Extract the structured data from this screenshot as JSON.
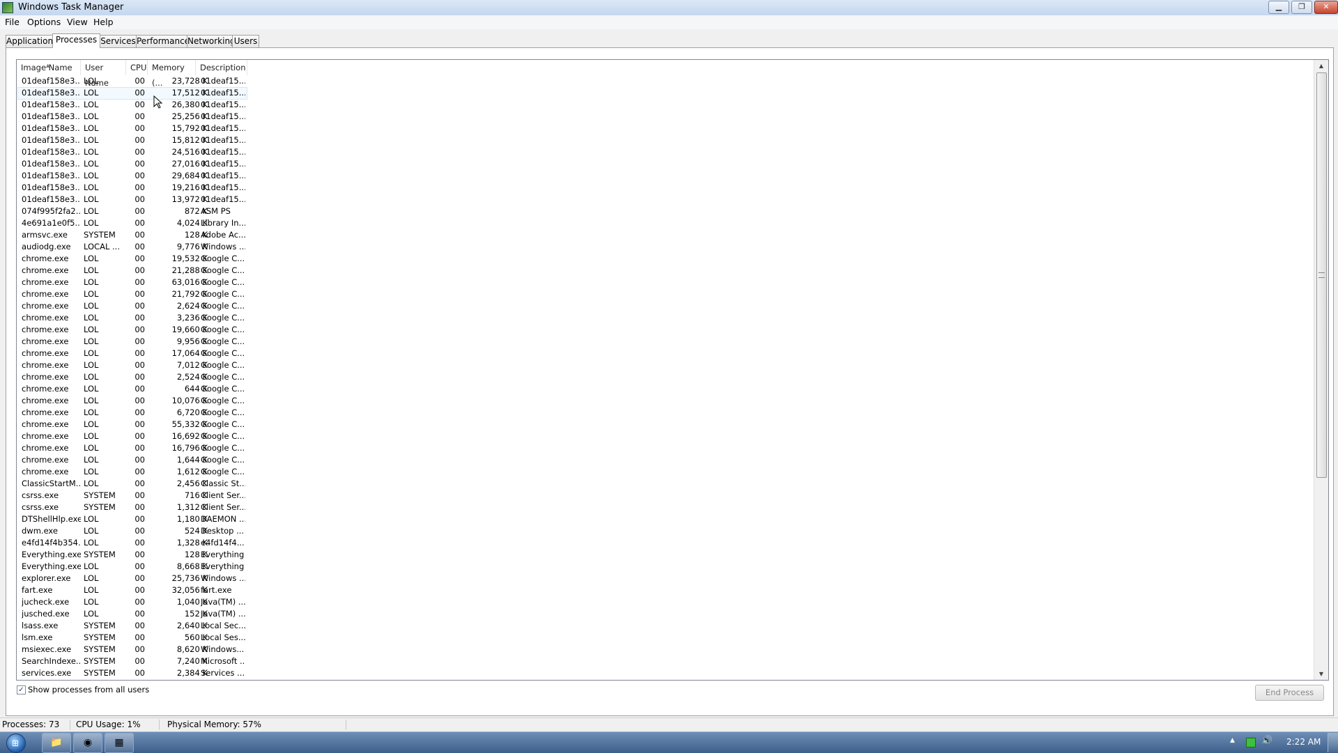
{
  "window": {
    "title": "Windows Task Manager",
    "min_glyph": "▁",
    "max_glyph": "❐",
    "close_glyph": "✕"
  },
  "menu": [
    "File",
    "Options",
    "View",
    "Help"
  ],
  "tabs": [
    "Applications",
    "Processes",
    "Services",
    "Performance",
    "Networking",
    "Users"
  ],
  "active_tab": "Processes",
  "columns": [
    "Image Name",
    "User Name",
    "CPU",
    "Memory (...",
    "Description"
  ],
  "sort_glyph": "▲",
  "processes": [
    [
      "01deaf158e3...",
      "LOL",
      "00",
      "23,728 K",
      "01deaf15..."
    ],
    [
      "01deaf158e3...",
      "LOL",
      "00",
      "17,512 K",
      "01deaf15..."
    ],
    [
      "01deaf158e3...",
      "LOL",
      "00",
      "26,380 K",
      "01deaf15..."
    ],
    [
      "01deaf158e3...",
      "LOL",
      "00",
      "25,256 K",
      "01deaf15..."
    ],
    [
      "01deaf158e3...",
      "LOL",
      "00",
      "15,792 K",
      "01deaf15..."
    ],
    [
      "01deaf158e3...",
      "LOL",
      "00",
      "15,812 K",
      "01deaf15..."
    ],
    [
      "01deaf158e3...",
      "LOL",
      "00",
      "24,516 K",
      "01deaf15..."
    ],
    [
      "01deaf158e3...",
      "LOL",
      "00",
      "27,016 K",
      "01deaf15..."
    ],
    [
      "01deaf158e3...",
      "LOL",
      "00",
      "29,684 K",
      "01deaf15..."
    ],
    [
      "01deaf158e3...",
      "LOL",
      "00",
      "19,216 K",
      "01deaf15..."
    ],
    [
      "01deaf158e3...",
      "LOL",
      "00",
      "13,972 K",
      "01deaf15..."
    ],
    [
      "074f995f2fa2...",
      "LOL",
      "00",
      "872 K",
      "ASM PS"
    ],
    [
      "4e691a1e0f5...",
      "LOL",
      "00",
      "4,024 K",
      "Library In..."
    ],
    [
      "armsvc.exe",
      "SYSTEM",
      "00",
      "128 K",
      "Adobe Ac..."
    ],
    [
      "audiodg.exe",
      "LOCAL ...",
      "00",
      "9,776 K",
      "Windows ..."
    ],
    [
      "chrome.exe",
      "LOL",
      "00",
      "19,532 K",
      "Google C..."
    ],
    [
      "chrome.exe",
      "LOL",
      "00",
      "21,288 K",
      "Google C..."
    ],
    [
      "chrome.exe",
      "LOL",
      "00",
      "63,016 K",
      "Google C..."
    ],
    [
      "chrome.exe",
      "LOL",
      "00",
      "21,792 K",
      "Google C..."
    ],
    [
      "chrome.exe",
      "LOL",
      "00",
      "2,624 K",
      "Google C..."
    ],
    [
      "chrome.exe",
      "LOL",
      "00",
      "3,236 K",
      "Google C..."
    ],
    [
      "chrome.exe",
      "LOL",
      "00",
      "19,660 K",
      "Google C..."
    ],
    [
      "chrome.exe",
      "LOL",
      "00",
      "9,956 K",
      "Google C..."
    ],
    [
      "chrome.exe",
      "LOL",
      "00",
      "17,064 K",
      "Google C..."
    ],
    [
      "chrome.exe",
      "LOL",
      "00",
      "7,012 K",
      "Google C..."
    ],
    [
      "chrome.exe",
      "LOL",
      "00",
      "2,524 K",
      "Google C..."
    ],
    [
      "chrome.exe",
      "LOL",
      "00",
      "644 K",
      "Google C..."
    ],
    [
      "chrome.exe",
      "LOL",
      "00",
      "10,076 K",
      "Google C..."
    ],
    [
      "chrome.exe",
      "LOL",
      "00",
      "6,720 K",
      "Google C..."
    ],
    [
      "chrome.exe",
      "LOL",
      "00",
      "55,332 K",
      "Google C..."
    ],
    [
      "chrome.exe",
      "LOL",
      "00",
      "16,692 K",
      "Google C..."
    ],
    [
      "chrome.exe",
      "LOL",
      "00",
      "16,796 K",
      "Google C..."
    ],
    [
      "chrome.exe",
      "LOL",
      "00",
      "1,644 K",
      "Google C..."
    ],
    [
      "chrome.exe",
      "LOL",
      "00",
      "1,612 K",
      "Google C..."
    ],
    [
      "ClassicStartM...",
      "LOL",
      "00",
      "2,456 K",
      "Classic St..."
    ],
    [
      "csrss.exe",
      "SYSTEM",
      "00",
      "716 K",
      "Client Ser..."
    ],
    [
      "csrss.exe",
      "SYSTEM",
      "00",
      "1,312 K",
      "Client Ser..."
    ],
    [
      "DTShellHlp.exe",
      "LOL",
      "00",
      "1,180 K",
      "DAEMON ..."
    ],
    [
      "dwm.exe",
      "LOL",
      "00",
      "524 K",
      "Desktop ..."
    ],
    [
      "e4fd14f4b354...",
      "LOL",
      "00",
      "1,328 K",
      "e4fd14f4..."
    ],
    [
      "Everything.exe",
      "SYSTEM",
      "00",
      "128 K",
      "Everything"
    ],
    [
      "Everything.exe",
      "LOL",
      "00",
      "8,668 K",
      "Everything"
    ],
    [
      "explorer.exe",
      "LOL",
      "00",
      "25,736 K",
      "Windows ..."
    ],
    [
      "fart.exe",
      "LOL",
      "00",
      "32,056 K",
      "fart.exe"
    ],
    [
      "jucheck.exe",
      "LOL",
      "00",
      "1,040 K",
      "Java(TM) ..."
    ],
    [
      "jusched.exe",
      "LOL",
      "00",
      "152 K",
      "Java(TM) ..."
    ],
    [
      "lsass.exe",
      "SYSTEM",
      "00",
      "2,640 K",
      "Local Sec..."
    ],
    [
      "lsm.exe",
      "SYSTEM",
      "00",
      "560 K",
      "Local Ses..."
    ],
    [
      "msiexec.exe",
      "SYSTEM",
      "00",
      "8,620 K",
      "Windows..."
    ],
    [
      "SearchIndexe...",
      "SYSTEM",
      "00",
      "7,240 K",
      "Microsoft ..."
    ],
    [
      "services.exe",
      "SYSTEM",
      "00",
      "2,384 K",
      "Services ..."
    ]
  ],
  "selected_row": 1,
  "show_all_checked": true,
  "show_all_label": "Show processes from all users",
  "check_glyph": "✓",
  "end_process_label": "End Process",
  "status": {
    "processes": "Processes: 73",
    "cpu": "CPU Usage: 1%",
    "memory": "Physical Memory: 57%"
  },
  "scroll": {
    "up_glyph": "▲",
    "down_glyph": "▼"
  },
  "taskbar": {
    "start_glyph": "⊞",
    "apps": [
      {
        "name": "explorer-taskbar-button",
        "glyph": "📁"
      },
      {
        "name": "chrome-taskbar-button",
        "glyph": "◉"
      },
      {
        "name": "task-manager-taskbar-button",
        "glyph": "▦"
      }
    ],
    "tray_arrow": "▲",
    "volume_glyph": "🔊",
    "clock": "2:22 AM"
  }
}
